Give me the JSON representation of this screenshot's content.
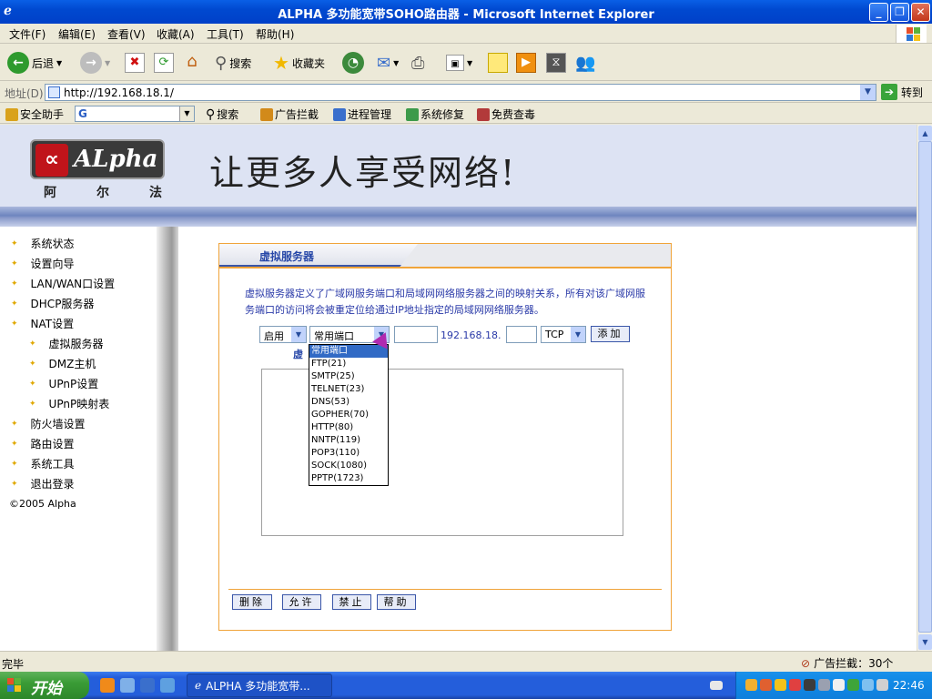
{
  "window": {
    "title": "ALPHA 多功能宽带SOHO路由器 - Microsoft Internet Explorer",
    "btn_min": "_",
    "btn_max": "❐",
    "btn_close": "✕"
  },
  "menubar": {
    "items": [
      "文件(F)",
      "编辑(E)",
      "查看(V)",
      "收藏(A)",
      "工具(T)",
      "帮助(H)"
    ]
  },
  "toolbar": {
    "back_label": "后退",
    "search_label": "搜索",
    "favorites_label": "收藏夹"
  },
  "address": {
    "label": "地址(D)",
    "url": "http://192.168.18.1/",
    "go_label": "转到"
  },
  "links": {
    "assistant": "安全助手",
    "search": "搜索",
    "adblock": "广告拦截",
    "process": "进程管理",
    "repair": "系统修复",
    "antivirus": "免费查毒"
  },
  "page": {
    "logo_text": "ALpha",
    "logo_cn": [
      "阿",
      "尔",
      "法"
    ],
    "slogan": "让更多人享受网络!",
    "nav": [
      {
        "label": "系统状态",
        "sub": false
      },
      {
        "label": "设置向导",
        "sub": false
      },
      {
        "label": "LAN/WAN口设置",
        "sub": false
      },
      {
        "label": "DHCP服务器",
        "sub": false
      },
      {
        "label": "NAT设置",
        "sub": false
      },
      {
        "label": "虚拟服务器",
        "sub": true
      },
      {
        "label": "DMZ主机",
        "sub": true
      },
      {
        "label": "UPnP设置",
        "sub": true
      },
      {
        "label": "UPnP映射表",
        "sub": true
      },
      {
        "label": "防火墙设置",
        "sub": false
      },
      {
        "label": "路由设置",
        "sub": false
      },
      {
        "label": "系统工具",
        "sub": false
      },
      {
        "label": "退出登录",
        "sub": false
      }
    ],
    "copyright": "©2005 Alpha",
    "panel": {
      "title": "虚拟服务器",
      "description": "虚拟服务器定义了广域网服务端口和局域网网络服务器之间的映射关系，所有对该广域网服务端口的访问将会被重定位给通过IP地址指定的局域网网络服务器。",
      "enable_value": "启用",
      "port_select_value": "常用端口",
      "ip_prefix": "192.168.18.",
      "protocol_value": "TCP",
      "add_button": "添加",
      "link_text": "虚",
      "buttons": {
        "delete": "删除",
        "allow": "允许",
        "deny": "禁止",
        "help": "帮助"
      }
    },
    "dropdown_options": [
      "常用端口",
      "FTP(21)",
      "SMTP(25)",
      "TELNET(23)",
      "DNS(53)",
      "GOPHER(70)",
      "HTTP(80)",
      "NNTP(119)",
      "POP3(110)",
      "SOCK(1080)",
      "PPTP(1723)"
    ],
    "dropdown_selected": "常用端口"
  },
  "statusbar": {
    "left": "完毕",
    "right": "广告拦截：30个"
  },
  "taskbar": {
    "start": "开始",
    "task": "ALPHA 多功能宽带...",
    "clock": "22:46"
  },
  "colors": {
    "accent": "#316ac5",
    "panel_border": "#f0a43a",
    "link_blue": "#2848a8"
  }
}
